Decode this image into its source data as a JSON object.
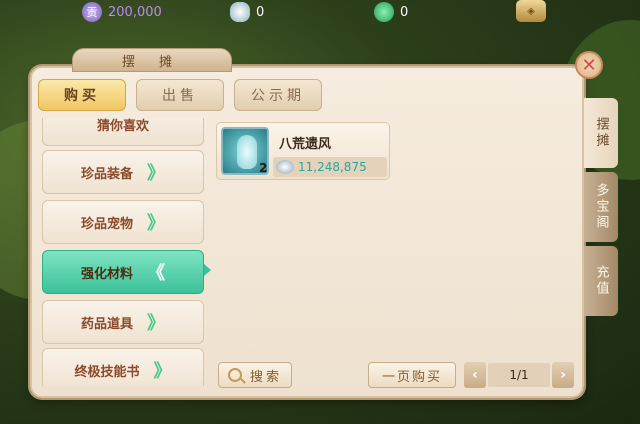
{
  "resources": {
    "gold": "200,000",
    "gold_icon_text": "贡",
    "silver": "0",
    "jade": "0"
  },
  "title": "摆 摊",
  "close_symbol": "✕",
  "top_tabs": [
    {
      "label": "购买",
      "active": true
    },
    {
      "label": "出售",
      "active": false
    },
    {
      "label": "公示期",
      "active": false
    }
  ],
  "categories": [
    {
      "label": "猜你喜欢",
      "active": false
    },
    {
      "label": "珍品装备",
      "active": false
    },
    {
      "label": "珍品宠物",
      "active": false
    },
    {
      "label": "强化材料",
      "active": true
    },
    {
      "label": "药品道具",
      "active": false
    },
    {
      "label": "终极技能书",
      "active": false
    }
  ],
  "chevrons": {
    "right": "》",
    "left": "《"
  },
  "listing": {
    "name": "八荒遗风",
    "quantity": "2",
    "price": "11,248,875"
  },
  "search_label": "搜索",
  "buy_page_label": "一页购买",
  "pager": {
    "prev": "‹",
    "next": "›",
    "page": "1/1"
  },
  "right_tabs": [
    {
      "label": "摆摊",
      "active": true
    },
    {
      "label": "多宝阁",
      "active": false
    },
    {
      "label": "充值",
      "active": false
    }
  ],
  "colors": {
    "accent_green": "#3bc29a",
    "price_teal": "#2aa5a2",
    "gold_text": "#b58cf0"
  }
}
